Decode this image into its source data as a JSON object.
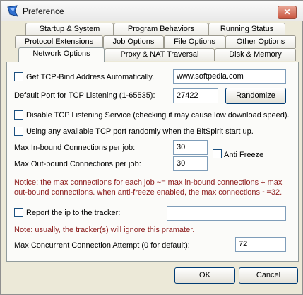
{
  "window": {
    "title": "Preference"
  },
  "tabs": {
    "row1": [
      "Startup & System",
      "Program Behaviors",
      "Running Status"
    ],
    "row2": [
      "Protocol Extensions",
      "Job Options",
      "File Options",
      "Other Options"
    ],
    "row3": [
      "Network Options",
      "Proxy & NAT Traversal",
      "Disk & Memory"
    ],
    "active": "Network Options"
  },
  "network": {
    "get_tcp_bind_label": "Get TCP-Bind Address Automatically.",
    "tcp_bind_address": "www.softpedia.com",
    "default_port_label": "Default Port for TCP Listening (1-65535):",
    "default_port_value": "27422",
    "randomize_label": "Randomize",
    "disable_tcp_label": "Disable TCP Listening Service (checking it may cause low download speed).",
    "any_port_label": "Using any available TCP port randomly when the BitSpirit start up.",
    "max_inbound_label": "Max In-bound Connections per job:",
    "max_inbound_value": "30",
    "max_outbound_label": "Max Out-bound Connections per job:",
    "max_outbound_value": "30",
    "anti_freeze_label": "Anti Freeze",
    "notice_1": "Notice: the max connections for each job ~= max in-bound connections + max out-bound connections. when anti-freeze enabled, the max connections ~=32.",
    "report_ip_label": "Report the ip to the tracker:",
    "report_ip_value": "",
    "notice_2": "Note: usually, the tracker(s) will ignore this pramater.",
    "max_concurrent_label": "Max Concurrent Connection Attempt (0 for default):",
    "max_concurrent_value": "72"
  },
  "footer": {
    "ok_label": "OK",
    "cancel_label": "Cancel"
  }
}
